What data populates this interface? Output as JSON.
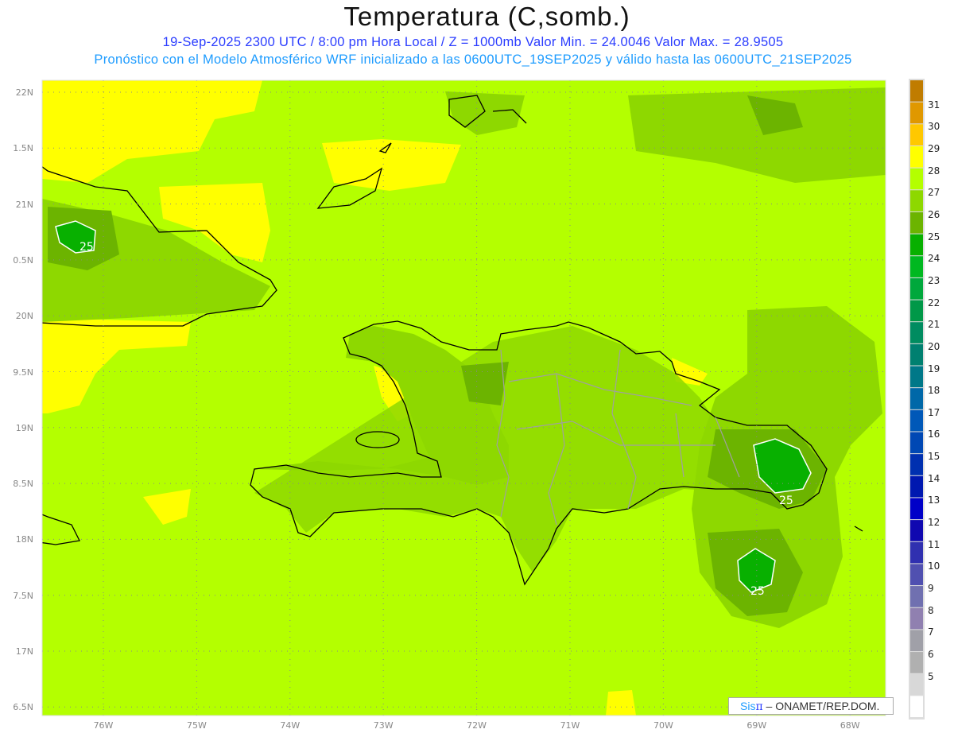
{
  "header": {
    "title": "Temperatura (C,somb.)",
    "subtitle_line1": "19-Sep-2025  2300 UTC / 8:00 pm Hora Local / Z = 1000mb   Valor Min. = 24.0046  Valor Max. = 28.9505",
    "subtitle_line2": "Pronóstico con el Modelo Atmosférico WRF inicializado a las 0600UTC_19SEP2025 y válido hasta las  0600UTC_21SEP2025"
  },
  "axes": {
    "lat_labels": [
      "22N",
      "1.5N",
      "21N",
      "0.5N",
      "20N",
      "9.5N",
      "19N",
      "8.5N",
      "18N",
      "7.5N",
      "17N",
      "6.5N"
    ],
    "lon_labels": [
      "76W",
      "75W",
      "74W",
      "73W",
      "72W",
      "71W",
      "70W",
      "69W",
      "68W"
    ]
  },
  "contour_labels": [
    "25",
    "25",
    "25"
  ],
  "colorbar": {
    "labels": [
      "31",
      "30",
      "29",
      "28",
      "27",
      "26",
      "25",
      "24",
      "23",
      "22",
      "21",
      "20",
      "19",
      "18",
      "17",
      "16",
      "15",
      "14",
      "13",
      "12",
      "11",
      "10",
      "9",
      "8",
      "7",
      "6",
      "5"
    ],
    "colors": [
      "#c07c00",
      "#e09800",
      "#ffc800",
      "#ffff00",
      "#b4ff00",
      "#8ed800",
      "#6cb400",
      "#08b000",
      "#00b820",
      "#00a83c",
      "#009848",
      "#008c60",
      "#008070",
      "#007888",
      "#0068a8",
      "#0058b8",
      "#0048b4",
      "#0030b0",
      "#0018b0",
      "#0000c8",
      "#1008b0",
      "#3030b0",
      "#5050b0",
      "#7070b0",
      "#9080b0",
      "#a0a0a8",
      "#b0b0b0",
      "#d8d8d8",
      "#ffffff"
    ]
  },
  "credit": {
    "brand_a": "Sis",
    "brand_b": "π",
    "text": "– ONAMET/REP.DOM."
  },
  "colors": {
    "base": "#b4ff00",
    "warm": "#ffff00",
    "mild": "#8ed800",
    "cool": "#6cb400",
    "cold": "#08b000",
    "coast": "#000000",
    "border": "#a0a0a0"
  }
}
